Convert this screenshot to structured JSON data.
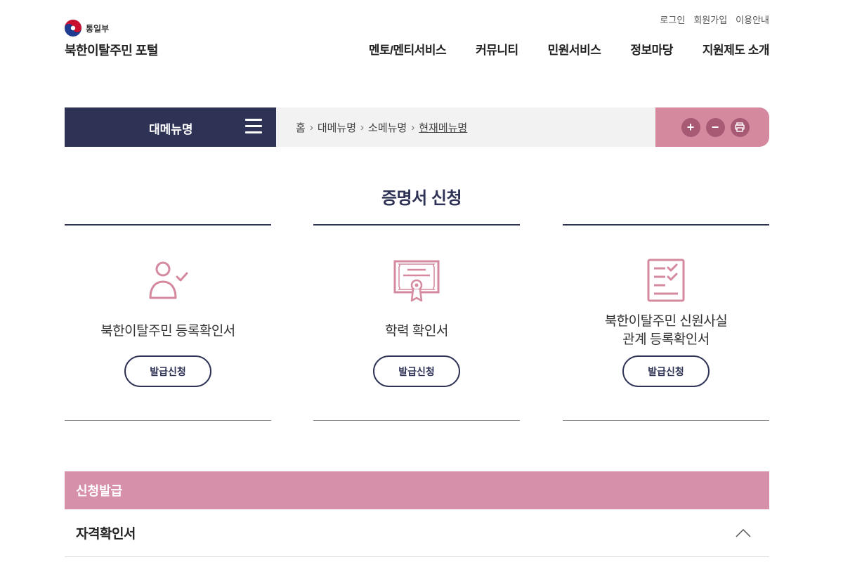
{
  "header": {
    "ministry": "통일부",
    "portal_name": "북한이탈주민 포털",
    "util_links": [
      "로그인",
      "회원가입",
      "이용안내"
    ],
    "gnb": [
      "멘토/멘티서비스",
      "커뮤니티",
      "민원서비스",
      "정보마당",
      "지원제도 소개"
    ]
  },
  "location": {
    "main_menu": "대메뉴명",
    "breadcrumb": [
      "홈",
      "대메뉴명",
      "소메뉴명",
      "현재메뉴명"
    ],
    "tools": {
      "zoom_in": "+",
      "zoom_out": "−"
    }
  },
  "page_title": "증명서 신청",
  "cards": [
    {
      "icon": "user-check-icon",
      "title": "북한이탈주민 등록확인서",
      "button": "발급신청"
    },
    {
      "icon": "certificate-icon",
      "title": "학력 확인서",
      "button": "발급신청"
    },
    {
      "icon": "checklist-icon",
      "title_line1": "북한이탈주민 신원사실",
      "title_line2": "관계 등록확인서",
      "button": "발급신청"
    }
  ],
  "accordion": {
    "header": "신청발급",
    "items": [
      "자격확인서"
    ]
  },
  "colors": {
    "navy": "#2e3356",
    "pink": "#d690aa",
    "icon_pink": "#d4899f"
  }
}
